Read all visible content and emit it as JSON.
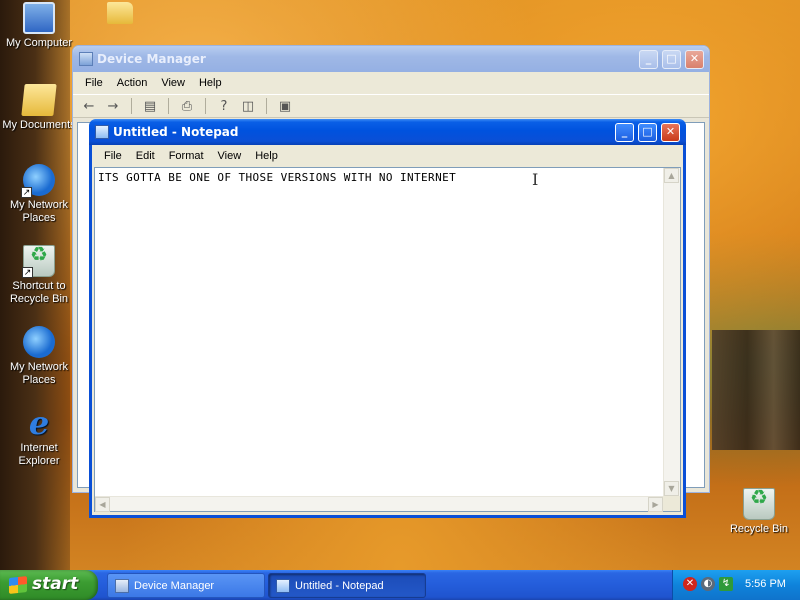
{
  "desktop": {
    "icons": [
      {
        "label": "My Computer",
        "icon": "computer-icon"
      },
      {
        "label": "My Documents",
        "icon": "documents-folder-icon"
      },
      {
        "label": "My Network Places",
        "icon": "network-places-icon"
      },
      {
        "label": "Shortcut to Recycle Bin",
        "icon": "recycle-bin-icon"
      },
      {
        "label": "My Network Places",
        "icon": "network-places-icon"
      },
      {
        "label": "Internet Explorer",
        "icon": "internet-explorer-icon"
      },
      {
        "label": "Recycle Bin",
        "icon": "recycle-bin-icon"
      }
    ]
  },
  "device_manager": {
    "title": "Device Manager",
    "menu": [
      "File",
      "Action",
      "View",
      "Help"
    ],
    "toolbar": [
      "back-icon",
      "forward-icon",
      "properties-icon",
      "print-icon",
      "help-icon",
      "view-icon",
      "scan-hardware-icon"
    ]
  },
  "notepad": {
    "title": "Untitled - Notepad",
    "menu": [
      "File",
      "Edit",
      "Format",
      "View",
      "Help"
    ],
    "content": "ITS GOTTA BE ONE OF THOSE VERSIONS WITH NO INTERNET"
  },
  "taskbar": {
    "start_label": "start",
    "tasks": [
      {
        "label": "Device Manager",
        "active": false
      },
      {
        "label": "Untitled - Notepad",
        "active": true
      }
    ],
    "tray_icons": [
      "security-alert-icon",
      "network-icon",
      "safely-remove-hardware-icon"
    ],
    "clock": "5:56 PM"
  },
  "colors": {
    "xp_blue": "#0a4fd6",
    "start_green": "#3c9d32",
    "window_face": "#ece9d8"
  }
}
